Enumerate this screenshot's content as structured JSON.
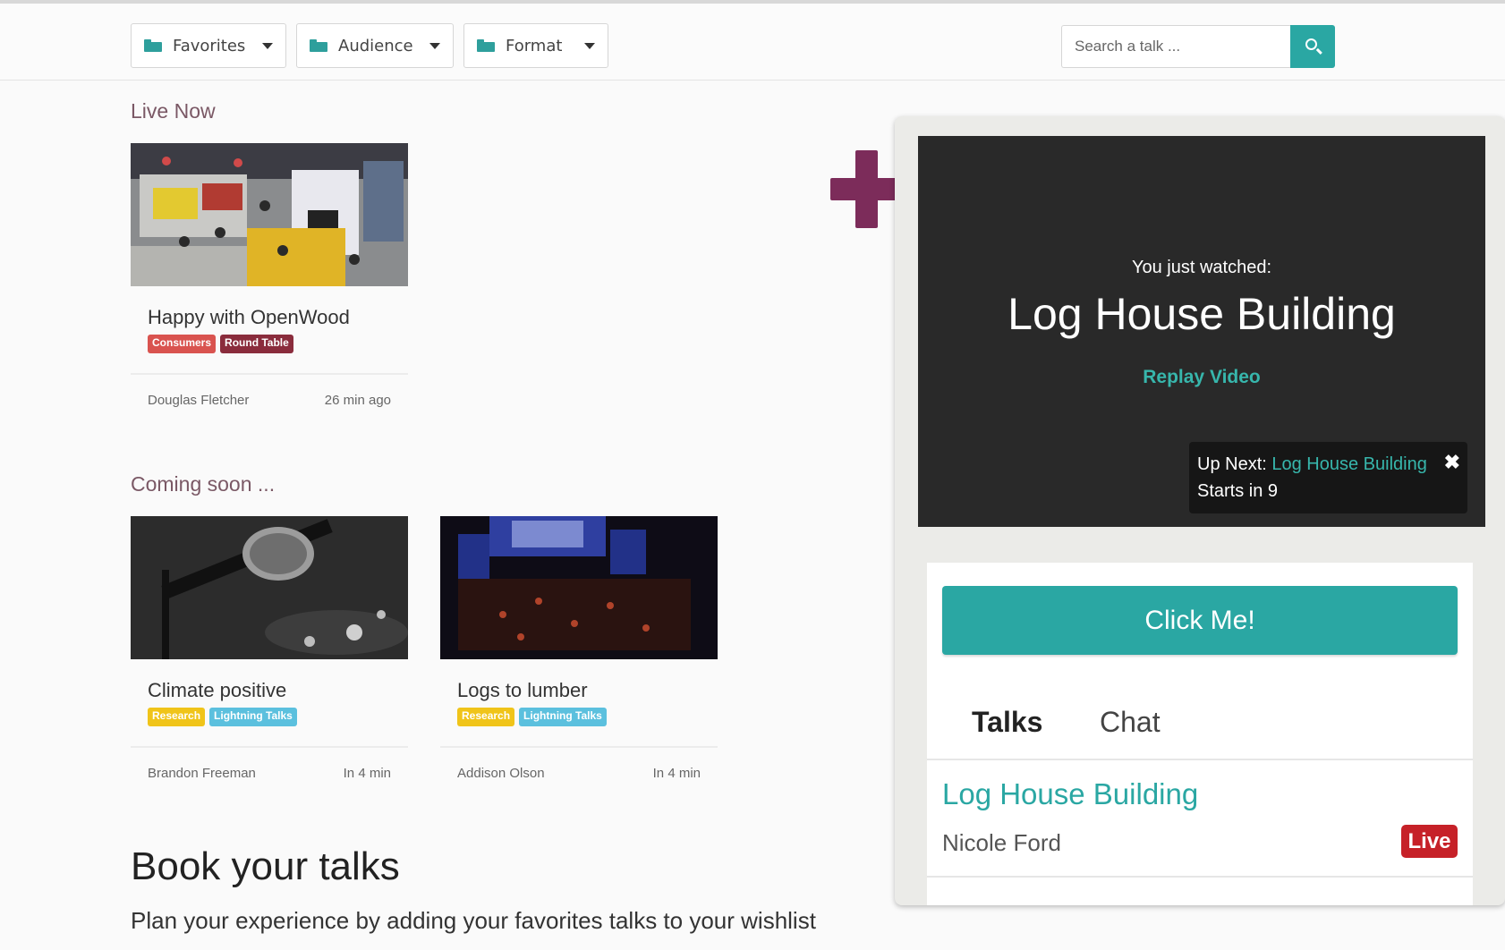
{
  "filters": [
    {
      "label": "Favorites",
      "icon": "folder-icon"
    },
    {
      "label": "Audience",
      "icon": "folder-icon"
    },
    {
      "label": "Format",
      "icon": "folder-icon"
    }
  ],
  "search": {
    "placeholder": "Search a talk ...",
    "icon": "search-icon"
  },
  "live_now": {
    "heading": "Live Now",
    "cards": [
      {
        "title": "Happy with OpenWood",
        "tags": [
          "Consumers",
          "Round Table"
        ],
        "speaker": "Douglas Fletcher",
        "time": "26 min ago"
      }
    ]
  },
  "coming_soon": {
    "heading": "Coming soon ...",
    "cards": [
      {
        "title": "Climate positive",
        "tags": [
          "Research",
          "Lightning Talks"
        ],
        "speaker": "Brandon Freeman",
        "time": "In 4 min"
      },
      {
        "title": "Logs to lumber",
        "tags": [
          "Research",
          "Lightning Talks"
        ],
        "speaker": "Addison Olson",
        "time": "In 4 min"
      }
    ]
  },
  "book": {
    "title": "Book your talks",
    "subtitle": "Plan your experience by adding your favorites talks to your wishlist"
  },
  "player": {
    "watched_label": "You just watched:",
    "watched_title": "Log House Building",
    "replay_label": "Replay Video",
    "upnext_label": "Up Next:",
    "upnext_title": "Log House Building",
    "starts_in": "Starts in 9",
    "close_icon": "close-icon"
  },
  "side": {
    "cta_label": "Click Me!",
    "tabs": [
      "Talks",
      "Chat"
    ],
    "talk": {
      "title": "Log House Building",
      "speaker": "Nicole Ford",
      "badge": "Live"
    }
  },
  "colors": {
    "accent": "#2aa7a3",
    "plum": "#7c2c5a",
    "live_red": "#c62128",
    "tag_consumers": "#d9534f",
    "tag_round_table": "#8a2c3c",
    "tag_research": "#f0c419",
    "tag_lightning": "#5bc0de"
  }
}
